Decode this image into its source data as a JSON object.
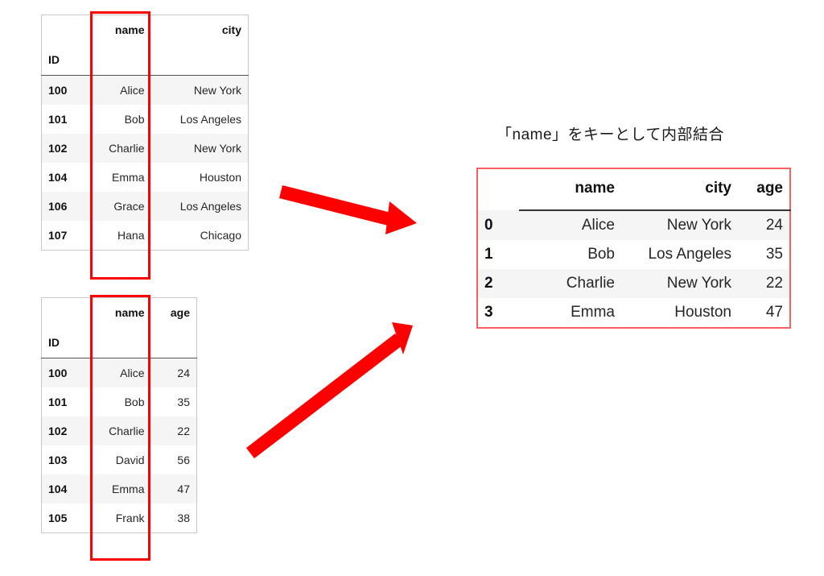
{
  "caption": {
    "join_note": "「name」をキーとして内部結合"
  },
  "colors": {
    "highlight_box": "#ff0000",
    "arrow": "#ff0000",
    "result_border": "#f9605f",
    "row_stripe": "#f5f5f5",
    "table_border": "#c9c9c9",
    "header_rule": "#555555"
  },
  "left_table": {
    "index_name": "ID",
    "columns": [
      "name",
      "city"
    ],
    "rows": [
      {
        "id": "100",
        "name": "Alice",
        "city": "New York"
      },
      {
        "id": "101",
        "name": "Bob",
        "city": "Los Angeles"
      },
      {
        "id": "102",
        "name": "Charlie",
        "city": "New York"
      },
      {
        "id": "104",
        "name": "Emma",
        "city": "Houston"
      },
      {
        "id": "106",
        "name": "Grace",
        "city": "Los Angeles"
      },
      {
        "id": "107",
        "name": "Hana",
        "city": "Chicago"
      }
    ],
    "highlighted_column": "name"
  },
  "right_table": {
    "index_name": "ID",
    "columns": [
      "name",
      "age"
    ],
    "rows": [
      {
        "id": "100",
        "name": "Alice",
        "age": "24"
      },
      {
        "id": "101",
        "name": "Bob",
        "age": "35"
      },
      {
        "id": "102",
        "name": "Charlie",
        "age": "22"
      },
      {
        "id": "103",
        "name": "David",
        "age": "56"
      },
      {
        "id": "104",
        "name": "Emma",
        "age": "47"
      },
      {
        "id": "105",
        "name": "Frank",
        "age": "38"
      }
    ],
    "highlighted_column": "name"
  },
  "result_table": {
    "columns": [
      "name",
      "city",
      "age"
    ],
    "rows": [
      {
        "idx": "0",
        "name": "Alice",
        "city": "New York",
        "age": "24"
      },
      {
        "idx": "1",
        "name": "Bob",
        "city": "Los Angeles",
        "age": "35"
      },
      {
        "idx": "2",
        "name": "Charlie",
        "city": "New York",
        "age": "22"
      },
      {
        "idx": "3",
        "name": "Emma",
        "city": "Houston",
        "age": "47"
      }
    ]
  },
  "arrows": [
    {
      "name": "arrow-left-table-to-result"
    },
    {
      "name": "arrow-right-table-to-result"
    }
  ]
}
